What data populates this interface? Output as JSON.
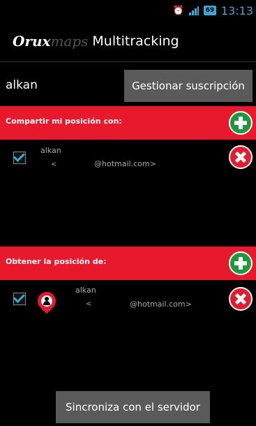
{
  "status_bar": {
    "time": "13:13",
    "battery": "69"
  },
  "action_bar": {
    "logo_bold": "Orux",
    "logo_light": "maps",
    "title": "Multitracking"
  },
  "user": {
    "name": "alkan",
    "manage_button": "Gestionar suscripción"
  },
  "share_section": {
    "header": "Compartir mi posición con:",
    "entries": [
      {
        "name": "alkan",
        "lt": "<",
        "email": "@hotmail.com>"
      }
    ]
  },
  "get_section": {
    "header": "Obtener la posición de:",
    "entries": [
      {
        "name": "alkan",
        "lt": "<",
        "email": "@hotmail.com>"
      }
    ]
  },
  "sync_button": "Sincroniza con el servidor",
  "colors": {
    "accent_red": "#e8192c",
    "add_green": "#1a9a3b",
    "holo_blue": "#3aa7d6"
  }
}
